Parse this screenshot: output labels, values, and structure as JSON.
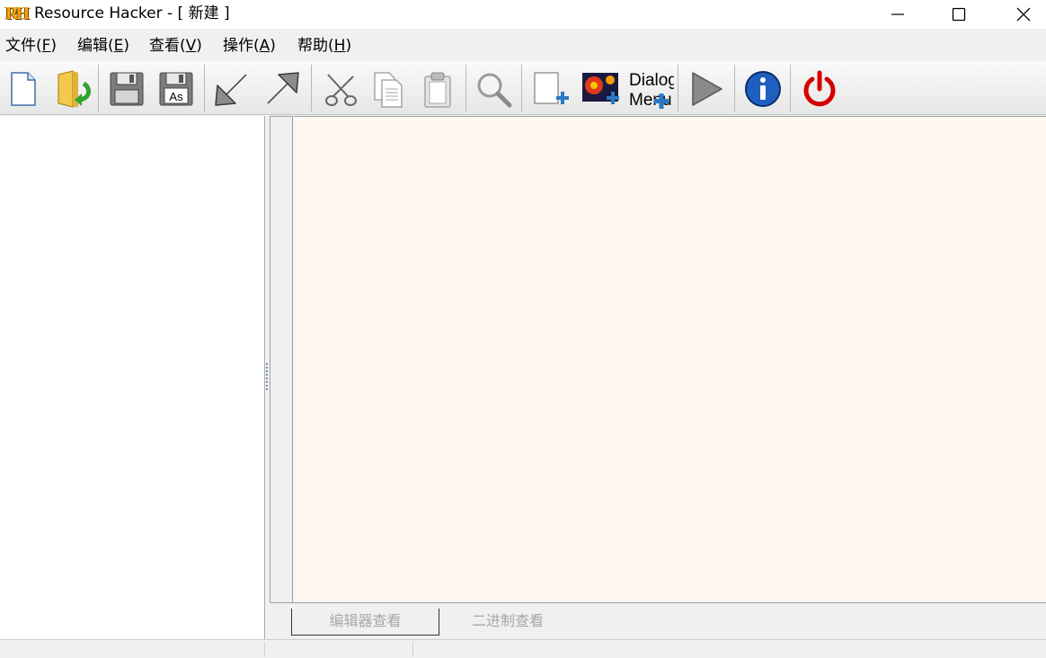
{
  "window": {
    "logo_text": "RH",
    "title": "Resource Hacker - [ 新建 ]"
  },
  "window_controls": [
    "minimize",
    "maximize",
    "close"
  ],
  "menu": {
    "file": {
      "label": "文件(",
      "key": "F",
      "suffix": ")"
    },
    "edit": {
      "label": "编辑(",
      "key": "E",
      "suffix": ")"
    },
    "view": {
      "label": "查看(",
      "key": "V",
      "suffix": ")"
    },
    "action": {
      "label": "操作(",
      "key": "A",
      "suffix": ")"
    },
    "help": {
      "label": "帮助(",
      "key": "H",
      "suffix": ")"
    }
  },
  "toolbar": {
    "buttons": [
      "new-file",
      "open-file",
      "save",
      "save-as",
      "import",
      "export",
      "cut",
      "copy",
      "paste",
      "find",
      "add-blank-resource",
      "add-image-resource",
      "dialog-merger",
      "run",
      "about",
      "exit"
    ],
    "dialog_merger_label_1": "Dialog",
    "dialog_merger_label_2": "Menu",
    "save_as_label": "As"
  },
  "colors": {
    "editor_bg": "#fff8f2",
    "exit_red": "#d40000",
    "info_blue": "#1f5fbf",
    "folder_yellow": "#f2c94c",
    "arrow_green": "#2fa52f"
  },
  "tabs": {
    "editor_view": "编辑器查看",
    "binary_view": "二进制查看"
  }
}
